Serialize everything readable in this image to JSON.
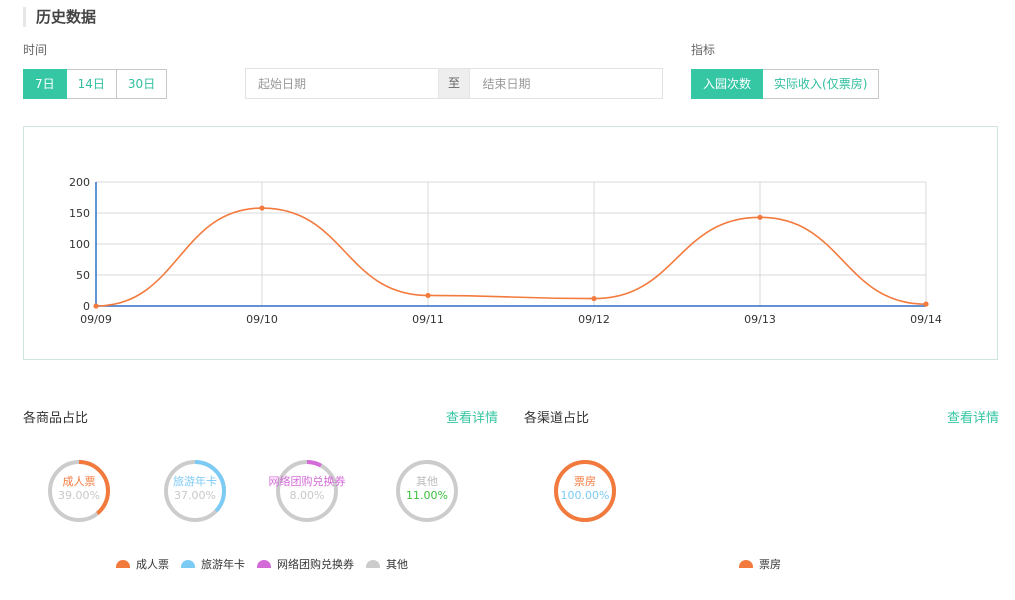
{
  "section_title": "历史数据",
  "time_label": "时间",
  "metric_label": "指标",
  "range_buttons": [
    "7日",
    "14日",
    "30日"
  ],
  "date_range": {
    "start_placeholder": "起始日期",
    "separator": "至",
    "end_placeholder": "结束日期"
  },
  "metric_buttons": [
    "入园次数",
    "实际收入(仅票房)"
  ],
  "colors": {
    "accent": "#35c6a3",
    "line": "#f37a3d",
    "axis": "#2e6fc7"
  },
  "chart_data": {
    "type": "line",
    "categories": [
      "09/09",
      "09/10",
      "09/11",
      "09/12",
      "09/13",
      "09/14"
    ],
    "series": [
      {
        "values": [
          0,
          158,
          17,
          12,
          143,
          3
        ]
      }
    ],
    "ylim": [
      0,
      200
    ],
    "yticks": [
      0,
      50,
      100,
      150,
      200
    ],
    "grid": true
  },
  "products": {
    "title": "各商品占比",
    "link": "查看详情",
    "items": [
      {
        "name": "成人票",
        "percent": "39.00%",
        "value": 39,
        "color": "#f37a3d",
        "name_color": "#f37a3d",
        "pct_color": "#c8c8c8"
      },
      {
        "name": "旅游年卡",
        "percent": "37.00%",
        "value": 37,
        "color": "#7ccbf5",
        "name_color": "#7ccbf5",
        "pct_color": "#c8c8c8"
      },
      {
        "name": "网络团购兑换券",
        "percent": "8.00%",
        "value": 8,
        "color": "#d46bd8",
        "name_color": "#d46bd8",
        "pct_color": "#c8c8c8"
      },
      {
        "name": "其他",
        "percent": "11.00%",
        "value": 11,
        "color": "#cccccc",
        "name_color": "#bbbbbb",
        "pct_color": "#3bbf3b"
      }
    ],
    "legend": [
      "成人票",
      "旅游年卡",
      "网络团购兑换券",
      "其他"
    ]
  },
  "channels": {
    "title": "各渠道占比",
    "link": "查看详情",
    "items": [
      {
        "name": "票房",
        "percent": "100.00%",
        "value": 100,
        "color": "#f37a3d",
        "name_color": "#f37a3d",
        "pct_color": "#7ccbf5"
      }
    ],
    "legend": [
      "票房"
    ]
  }
}
